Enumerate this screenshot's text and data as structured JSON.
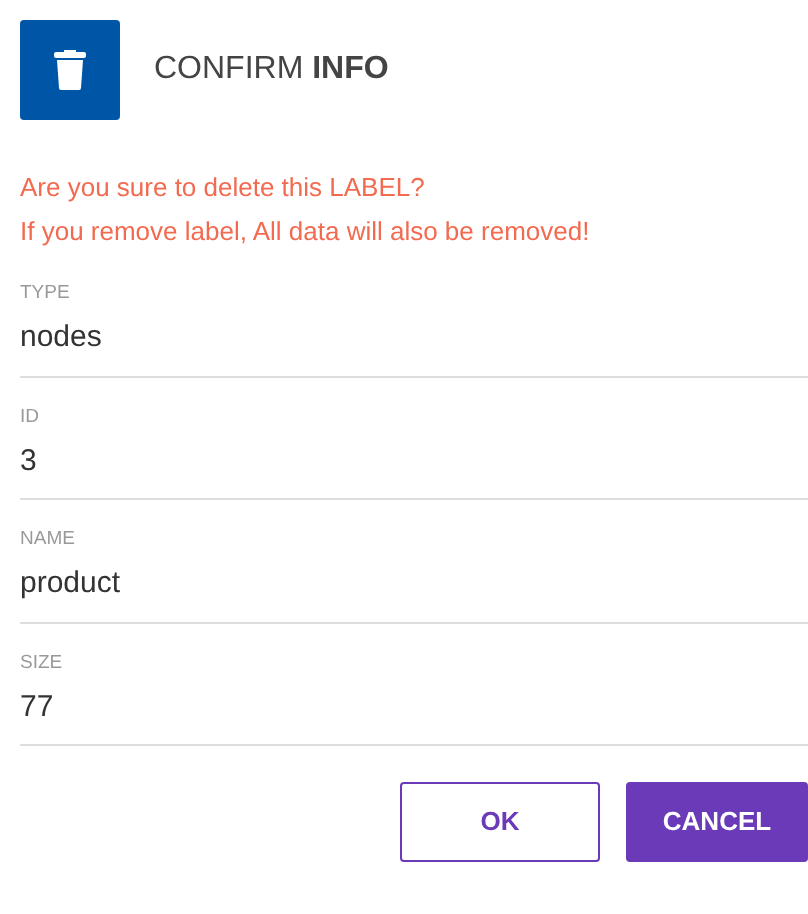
{
  "header": {
    "title": "CONFIRM **INFO**"
  },
  "warning": [
    "Are you sure to delete this LABEL?",
    "If you remove label, All data will also be removed!"
  ],
  "fields": [
    {
      "label": "TYPE",
      "value": "nodes"
    },
    {
      "label": "ID",
      "value": "3"
    },
    {
      "label": "NAME",
      "value": "product"
    },
    {
      "label": "SIZE",
      "value": "77"
    }
  ],
  "buttons": [
    {
      "label": "OK",
      "kind": "outline"
    },
    {
      "label": "CANCEL",
      "kind": "filled"
    }
  ]
}
